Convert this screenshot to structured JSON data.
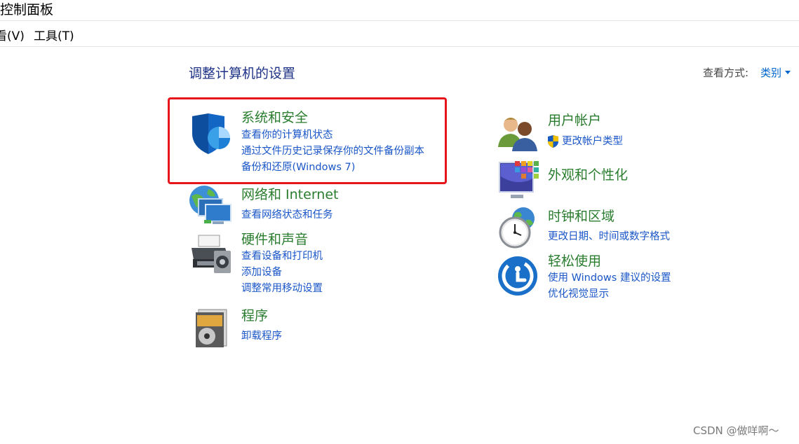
{
  "window": {
    "title": "控制面板"
  },
  "menu": {
    "view": "看(V)",
    "tools": "工具(T)"
  },
  "header": {
    "title": "调整计算机的设置",
    "view_by_label": "查看方式:",
    "view_by_value": "类别"
  },
  "left_categories": [
    {
      "title": "系统和安全",
      "icon": "shield-icon",
      "links": [
        "查看你的计算机状态",
        "通过文件历史记录保存你的文件备份副本",
        "备份和还原(Windows 7)"
      ]
    },
    {
      "title": "网络和 Internet",
      "icon": "network-icon",
      "links": [
        "查看网络状态和任务"
      ]
    },
    {
      "title": "硬件和声音",
      "icon": "printer-icon",
      "links": [
        "查看设备和打印机",
        "添加设备",
        "调整常用移动设置"
      ]
    },
    {
      "title": "程序",
      "icon": "programs-icon",
      "links": [
        "卸载程序"
      ]
    }
  ],
  "right_categories": [
    {
      "title": "用户帐户",
      "icon": "users-icon",
      "links": [
        "更改帐户类型"
      ]
    },
    {
      "title": "外观和个性化",
      "icon": "monitor-palette-icon",
      "links": []
    },
    {
      "title": "时钟和区域",
      "icon": "clock-globe-icon",
      "links": [
        "更改日期、时间或数字格式"
      ]
    },
    {
      "title": "轻松使用",
      "icon": "ease-of-access-icon",
      "links": [
        "使用 Windows 建议的设置",
        "优化视觉显示"
      ]
    }
  ],
  "colors": {
    "category_title": "#2a7d2e",
    "link": "#1a56c8",
    "highlight": "#e8141c",
    "page_title": "#1e3287"
  },
  "watermark": "CSDN @做咩啊～"
}
